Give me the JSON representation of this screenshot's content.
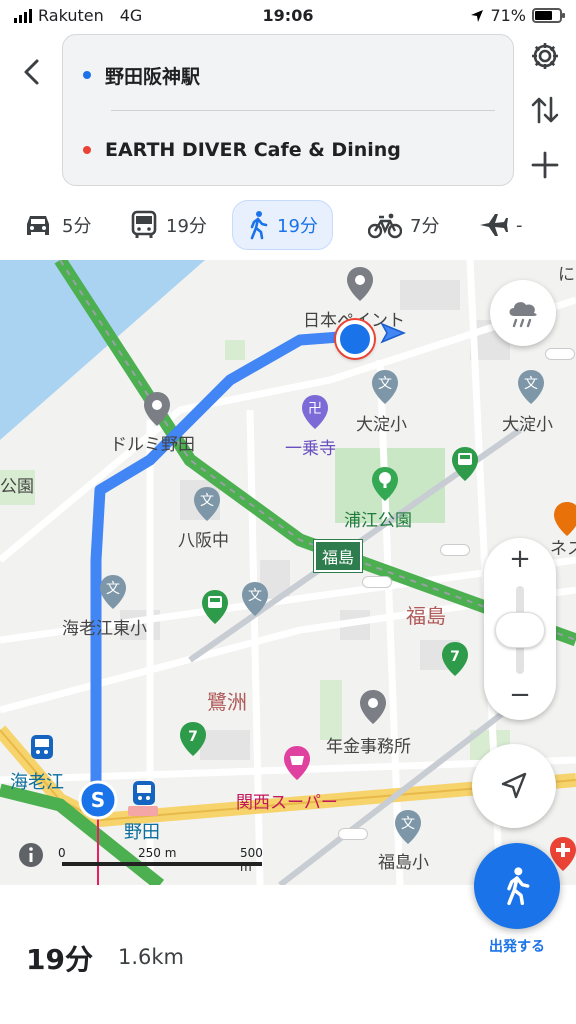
{
  "status_bar": {
    "carrier": "Rakuten",
    "network": "4G",
    "time": "19:06",
    "battery": "71%",
    "battery_level": 0.71
  },
  "route": {
    "origin": "野田阪神駅",
    "destination": "EARTH DIVER Cafe & Dining",
    "origin_color": "#1a73e8",
    "destination_color": "#ea4335"
  },
  "modes": [
    {
      "name": "car",
      "label": "5分"
    },
    {
      "name": "transit",
      "label": "19分"
    },
    {
      "name": "walk",
      "label": "19分",
      "active": true
    },
    {
      "name": "bike",
      "label": "7分"
    },
    {
      "name": "flight",
      "label": "-"
    }
  ],
  "map": {
    "labels": {
      "nihon_paint": "日本ペイント",
      "domi_noda": "ドルミ野田",
      "ichijoji": "一乗寺",
      "oyodo_sho_1": "大淀小",
      "oyodo_sho_2": "大淀小",
      "urae_park": "浦江公園",
      "yasaka_chu": "八阪中",
      "fukushima_sign": "福島",
      "fukushima_district": "福島",
      "ebie_higashi": "海老江東小",
      "sagisu": "鷺洲",
      "nenkin": "年金事務所",
      "kansai_super": "関西スーパー",
      "ebie": "海老江",
      "noda": "野田",
      "fukushima_sho": "福島小",
      "park_edge": "公園",
      "edge_top": "にわ",
      "edge_ne": "ネス"
    },
    "scale": {
      "zero": "0",
      "mid": "250 m",
      "end": "500 m"
    },
    "colors": {
      "route": "#4285f4",
      "rail": "#4caf50",
      "water": "#aad3f2",
      "highway": "#f6d36b"
    }
  },
  "summary": {
    "time": "19分",
    "distance": "1.6km",
    "start_label": "出発する"
  }
}
